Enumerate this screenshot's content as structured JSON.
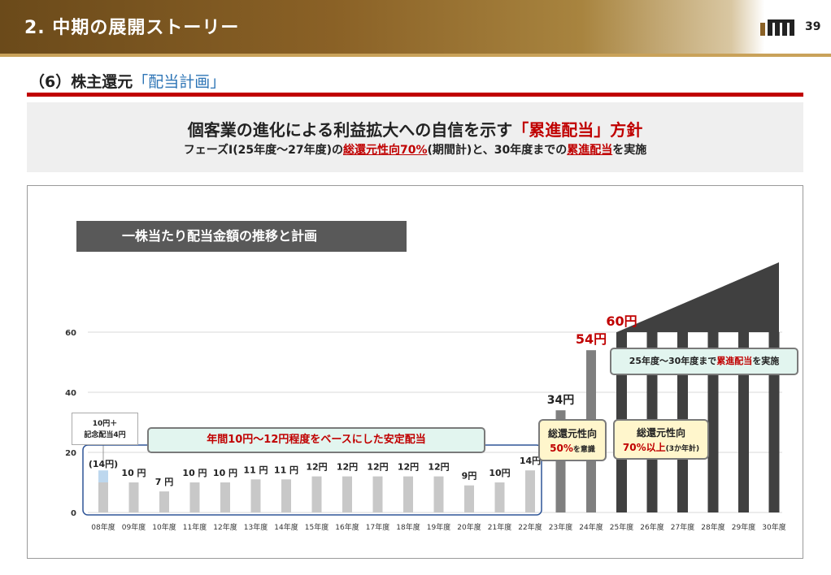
{
  "header": {
    "title": "2. 中期の展開ストーリー",
    "page_number": "39"
  },
  "section": {
    "prefix": "（6）株主還元",
    "highlight": "「配当計画」"
  },
  "policy": {
    "headline_main": "個客業の進化による利益拡大への自信を示す",
    "headline_red": "「累進配当」方針",
    "sub_a": "フェーズⅠ(25年度～27年度)の",
    "sub_b": "総還元性向70%",
    "sub_c": "(期間計)と、30年度までの",
    "sub_d": "累進配当",
    "sub_e": "を実施"
  },
  "chart_box_title": "一株当たり配当金額の推移と計画",
  "callouts": {
    "range_a": "年間10円～12円程度をベースにした",
    "range_b": "安定配当",
    "memo_1": "10円＋",
    "memo_2": "記念配当4円",
    "plan_a": "25年度～30年度まで",
    "plan_b": "累進配当",
    "plan_c": "を実施",
    "p50_title": "総還元性向",
    "p50_value": "50%",
    "p50_note": "を意識",
    "p70_title": "総還元性向",
    "p70_value": "70%以上",
    "p70_note": "(3か年計)"
  },
  "colors": {
    "past_bar": "#c8c8c8",
    "recent_bar": "#7f7f7f",
    "plan_bar": "#404040",
    "accent_red": "#c00000",
    "memo_bar": "#bdd7ee"
  },
  "chart_data": {
    "type": "bar",
    "categories": [
      "08年度",
      "09年度",
      "10年度",
      "11年度",
      "12年度",
      "13年度",
      "14年度",
      "15年度",
      "16年度",
      "17年度",
      "18年度",
      "19年度",
      "20年度",
      "21年度",
      "22年度",
      "23年度",
      "24年度",
      "25年度",
      "26年度",
      "27年度",
      "28年度",
      "29年度",
      "30年度"
    ],
    "values": [
      14,
      10,
      7,
      10,
      10,
      11,
      11,
      12,
      12,
      12,
      12,
      12,
      9,
      10,
      14,
      34,
      54,
      60,
      60,
      60,
      60,
      60,
      60
    ],
    "value_labels": [
      "(14円)",
      "10 円",
      "7 円",
      "10 円",
      "10 円",
      "11 円",
      "11 円",
      "12円",
      "12円",
      "12円",
      "12円",
      "12円",
      "9円",
      "10円",
      "14円",
      "34円",
      "54円",
      "60円",
      "",
      "",
      "",
      "",
      ""
    ],
    "y_ticks": [
      0,
      20,
      40,
      60
    ],
    "ylim": [
      0,
      80
    ],
    "grid": true
  }
}
